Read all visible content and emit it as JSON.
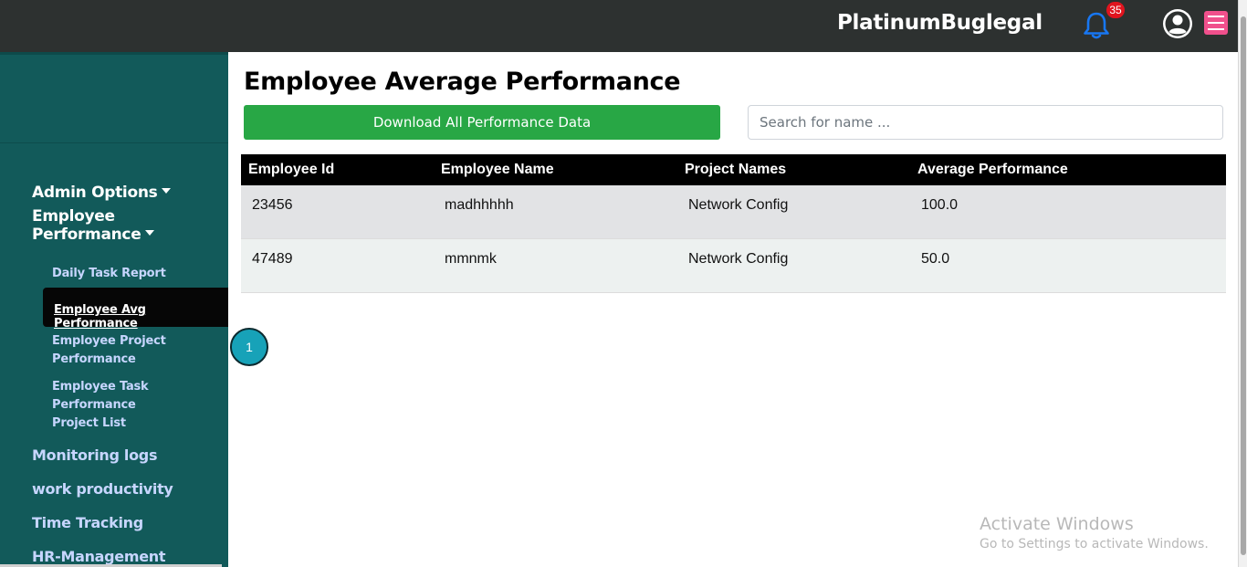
{
  "header": {
    "brand": "PlatinumBuglegal",
    "notification_count": "35",
    "icons": [
      "bell-icon",
      "user-avatar-icon",
      "hamburger-menu-icon"
    ]
  },
  "sidebar": {
    "sections": {
      "admin_options": "Admin Options",
      "employee_performance": "Employee Performance"
    },
    "sub_items": {
      "daily_task_report": "Daily Task Report",
      "employee_avg_performance": "Employee Avg Performance",
      "employee_project_performance_l1": "Employee Project",
      "employee_project_performance_l2": "Performance",
      "employee_task_performance": "Employee Task Performance",
      "project_list": "Project List"
    },
    "bottom_sections": {
      "monitoring_logs": "Monitoring logs",
      "work_productivity": "work productivity",
      "time_tracking": "Time Tracking",
      "hr_management": "HR-Management"
    },
    "colors": {
      "background": "#125a5a",
      "active": "#060606",
      "link": "#c7d6ff"
    }
  },
  "main": {
    "title": "Employee Average Performance",
    "download_button": "Download All Performance Data",
    "search_placeholder": "Search for name ...",
    "table": {
      "headers": [
        "Employee Id",
        "Employee Name",
        "Project Names",
        "Average Performance"
      ],
      "rows": [
        [
          "23456",
          "madhhhhh",
          "Network Config",
          "100.0"
        ],
        [
          "47489",
          "mmnmk",
          "Network Config",
          "50.0"
        ]
      ]
    },
    "pagination": {
      "current_page": "1"
    },
    "colors": {
      "download": "#28a745",
      "header_bg": "#000000",
      "page_button": "#17a2b8"
    }
  },
  "watermark": {
    "line1": "Activate Windows",
    "line2": "Go to Settings to activate Windows."
  }
}
